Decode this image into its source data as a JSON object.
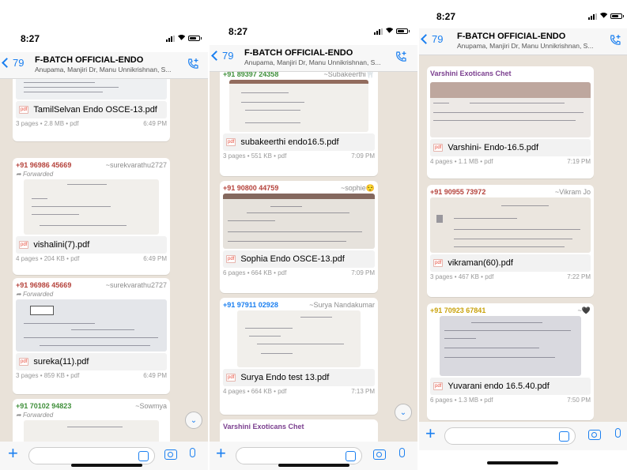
{
  "colors": {
    "accent": "#1a7ff0",
    "chat_bg": "#e9e2d9",
    "sender_red": "#b5433c",
    "sender_purple": "#7b3f8f",
    "sender_green": "#3f8f3a",
    "sender_gold": "#c9a20b"
  },
  "phones": [
    {
      "time": "8:27",
      "back_count": "79",
      "group_title": "F-BATCH OFFICIAL-ENDO",
      "members": "Anupama, Manjiri Dr, Manu Unnikrishnan, S...",
      "messages": [
        {
          "sender": "",
          "alias": "",
          "forwarded": "",
          "file": "TamilSelvan Endo OSCE-13.pdf",
          "meta": "3 pages • 2.8 MB • pdf",
          "time": "6:49 PM"
        },
        {
          "sender": "+91 96986 45669",
          "alias": "~surekvarathu2727",
          "forwarded": "Forwarded",
          "file": "vishalini(7).pdf",
          "meta": "4 pages • 204 KB • pdf",
          "time": "6:49 PM"
        },
        {
          "sender": "+91 96986 45669",
          "alias": "~surekvarathu2727",
          "forwarded": "Forwarded",
          "file": "sureka(11).pdf",
          "meta": "3 pages • 859 KB • pdf",
          "time": "6:49 PM"
        },
        {
          "sender": "+91 70102 94823",
          "alias": "~Sowmya",
          "forwarded": "Forwarded",
          "file": "",
          "meta": "",
          "time": ""
        }
      ]
    },
    {
      "time": "8:27",
      "back_count": "79",
      "group_title": "F-BATCH OFFICIAL-ENDO",
      "members": "Anupama, Manjiri Dr, Manu Unnikrishnan, S...",
      "messages": [
        {
          "sender": "+91 89397 24358",
          "alias": "~Subakeerthi🦷",
          "forwarded": "",
          "file": "subakeerthi endo16.5.pdf",
          "meta": "3 pages • 551 KB • pdf",
          "time": "7:09 PM"
        },
        {
          "sender": "+91 90800 44759",
          "alias": "~sophie😌",
          "forwarded": "",
          "file": "Sophia Endo OSCE-13.pdf",
          "meta": "6 pages • 664 KB • pdf",
          "time": "7:09 PM"
        },
        {
          "sender": "+91 97911 02928",
          "alias": "~Surya Nandakumar",
          "forwarded": "",
          "file": "Surya Endo test 13.pdf",
          "meta": "4 pages • 664 KB • pdf",
          "time": "7:13 PM"
        },
        {
          "sender": "Varshini Exoticans Chet",
          "alias": "",
          "forwarded": "",
          "file": "",
          "meta": "",
          "time": ""
        }
      ]
    },
    {
      "time": "8:27",
      "back_count": "79",
      "group_title": "F-BATCH OFFICIAL-ENDO",
      "members": "Anupama, Manjiri Dr, Manu Unnikrishnan, S...",
      "messages": [
        {
          "sender": "Varshini Exoticans Chet",
          "alias": "",
          "forwarded": "",
          "file": "Varshini- Endo-16.5.pdf",
          "meta": "4 pages • 1.1 MB • pdf",
          "time": "7:19 PM"
        },
        {
          "sender": "+91 90955 73972",
          "alias": "~Vikram Jo",
          "forwarded": "",
          "file": "vikraman(60).pdf",
          "meta": "3 pages • 467 KB • pdf",
          "time": "7:22 PM"
        },
        {
          "sender": "+91 70923 67841",
          "alias": "~🖤",
          "forwarded": "",
          "file": "Yuvarani endo 16.5.40.pdf",
          "meta": "6 pages • 1.3 MB • pdf",
          "time": "7:50 PM"
        }
      ]
    }
  ]
}
